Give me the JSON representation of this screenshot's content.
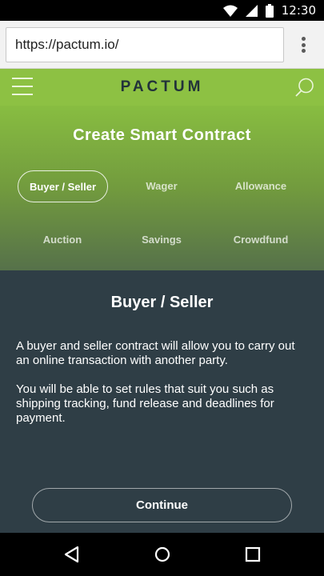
{
  "status_bar": {
    "time": "12:30",
    "icons": [
      "wifi-icon",
      "cell-signal-icon",
      "battery-icon"
    ]
  },
  "browser": {
    "url": "https://pactum.io/",
    "menu_icon": "overflow-menu-icon"
  },
  "header": {
    "brand": "PACTUM",
    "menu_icon": "hamburger-icon",
    "search_icon": "search-icon"
  },
  "hero": {
    "title": "Create Smart Contract",
    "tabs": [
      {
        "label": "Buyer / Seller",
        "active": true
      },
      {
        "label": "Wager",
        "active": false
      },
      {
        "label": "Allowance",
        "active": false
      },
      {
        "label": "Auction",
        "active": false
      },
      {
        "label": "Savings",
        "active": false
      },
      {
        "label": "Crowdfund",
        "active": false
      }
    ]
  },
  "content": {
    "title": "Buyer / Seller",
    "paragraphs": [
      "A buyer and seller contract will allow you to carry out an online transaction with another party.",
      "You will be able to set rules that suit you such as shipping tracking, fund release and deadlines for payment."
    ],
    "continue_label": "Continue"
  },
  "nav_bar": {
    "icons": [
      "back-icon",
      "home-icon",
      "recents-icon"
    ]
  },
  "colors": {
    "brand_green": "#8dc143",
    "panel_dark": "#2f3e46",
    "brand_text": "#22323a"
  }
}
